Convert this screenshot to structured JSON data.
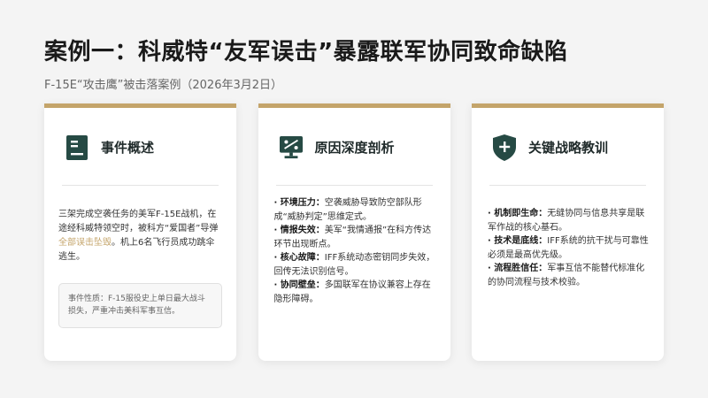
{
  "title": "案例一：科威特“友军误击”暴露联军协同致命缺陷",
  "subtitle": "F-15E“攻击鹰”被击落案例（2026年3月2日）",
  "colors": {
    "accent": "#c4a46a",
    "icon": "#264a44",
    "background": "#f4f4f4"
  },
  "cards": [
    {
      "icon": "document-icon",
      "title": "事件概述",
      "body_pre": "三架完成空袭任务的美军F-15E战机，在途经科威特领空时，被科方“爱国者”导弹",
      "body_highlight": "全部误击坠毁",
      "body_post": "。机上6名飞行员成功跳伞逃生。",
      "note": "事件性质：F-15服役史上单日最大战斗损失，严重冲击美科军事互信。"
    },
    {
      "icon": "monitor-chart-icon",
      "title": "原因深度剖析",
      "items": [
        {
          "key": "· 环境压力：",
          "text": "空袭威胁导致防空部队形成“威胁判定”思维定式。"
        },
        {
          "key": "· 情报失效：",
          "text": "美军“我情通报”在科方传达环节出现断点。"
        },
        {
          "key": "· 核心故障：",
          "text": "IFF系统动态密钥同步失效，回传无法识别信号。"
        },
        {
          "key": "· 协同壁垒：",
          "text": "多国联军在协议兼容上存在隐形障碍。"
        }
      ]
    },
    {
      "icon": "shield-plus-icon",
      "title": "关键战略教训",
      "items": [
        {
          "key": "· 机制即生命：",
          "text": "无缝协同与信息共享是联军作战的核心基石。"
        },
        {
          "key": "· 技术是底线：",
          "text": "IFF系统的抗干扰与可靠性必须是最高优先级。"
        },
        {
          "key": "· 流程胜信任：",
          "text": "军事互信不能替代标准化的协同流程与技术校验。"
        }
      ]
    }
  ]
}
